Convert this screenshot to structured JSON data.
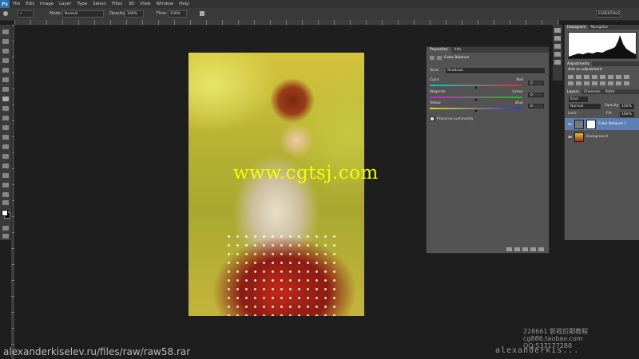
{
  "app": {
    "logo": "Ps"
  },
  "menu": [
    "File",
    "Edit",
    "Image",
    "Layer",
    "Type",
    "Select",
    "Filter",
    "3D",
    "View",
    "Window",
    "Help"
  ],
  "options_bar": {
    "mode_label": "Mode:",
    "mode_value": "Normal",
    "opacity_label": "Opacity:",
    "opacity_value": "100%",
    "flow_label": "Flow:",
    "flow_value": "100%",
    "workspace": "ESSENTIALS"
  },
  "watermark_text": "www.cgtsj.com",
  "properties_panel": {
    "tabs": [
      "Properties",
      "Info"
    ],
    "title": "Color Balance",
    "tone_label": "Tone:",
    "tone_value": "Shadows",
    "sliders": [
      {
        "left": "Cyan",
        "right": "Red",
        "value": "0",
        "fraction": 0.5,
        "colors": [
          "#00c8c8",
          "#e03030"
        ]
      },
      {
        "left": "Magenta",
        "right": "Green",
        "value": "0",
        "fraction": 0.5,
        "colors": [
          "#d020d0",
          "#20c020"
        ]
      },
      {
        "left": "Yellow",
        "right": "Blue",
        "value": "0",
        "fraction": 0.5,
        "colors": [
          "#d8d820",
          "#3030e0"
        ]
      }
    ],
    "preserve_label": "Preserve Luminosity"
  },
  "right_dock": {
    "histogram_tabs": [
      "Histogram",
      "Navigator"
    ],
    "adjustments_tab": "Adjustments",
    "add_adjustment": "Add an adjustment",
    "layers_tabs": [
      "Layers",
      "Channels",
      "Paths"
    ],
    "kind_label": "Kind",
    "blend_value": "Normal",
    "opacity_label": "Opacity:",
    "opacity_value": "100%",
    "lock_label": "Lock:",
    "fill_label": "Fill:",
    "fill_value": "100%",
    "layers": [
      {
        "name": "Color Balance 1",
        "selected": true
      },
      {
        "name": "Background",
        "selected": false
      }
    ]
  },
  "overlay": {
    "bottom_left": "alexanderkiselev.ru/files/raw/raw58.rar",
    "bottom_right": "alexanderkis...",
    "corner_line1": "228661 影视后期教程",
    "corner_line2": "cg886.taobao.com",
    "corner_line3": "QQ:537177288"
  }
}
